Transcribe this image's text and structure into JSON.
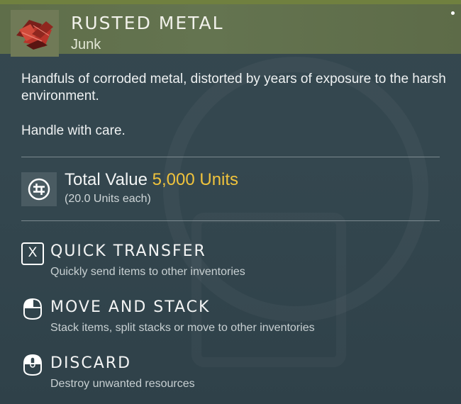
{
  "colors": {
    "header_bg": "#647450",
    "panel_bg": "#34474f",
    "value_accent": "#f0c33c",
    "text_primary": "#f3f4f4",
    "text_secondary": "#c8d0d2"
  },
  "item": {
    "icon": "rusted-metal-icon",
    "title": "RUSTED METAL",
    "category": "Junk",
    "description": "Handfuls of corroded metal, distorted by years of exposure to the harsh environment.",
    "note": "Handle with care."
  },
  "value": {
    "icon": "units-currency-icon",
    "label": "Total Value",
    "amount": "5,000 Units",
    "each": "(20.0 Units each)"
  },
  "actions": [
    {
      "icon": "x-key-icon",
      "key": "X",
      "label": "QUICK TRANSFER",
      "description": "Quickly send items to other inventories"
    },
    {
      "icon": "mouse-left-click-icon",
      "label": "MOVE AND STACK",
      "description": "Stack items, split stacks or move to other inventories"
    },
    {
      "icon": "mouse-middle-click-icon",
      "label": "DISCARD",
      "description": "Destroy unwanted resources"
    }
  ]
}
